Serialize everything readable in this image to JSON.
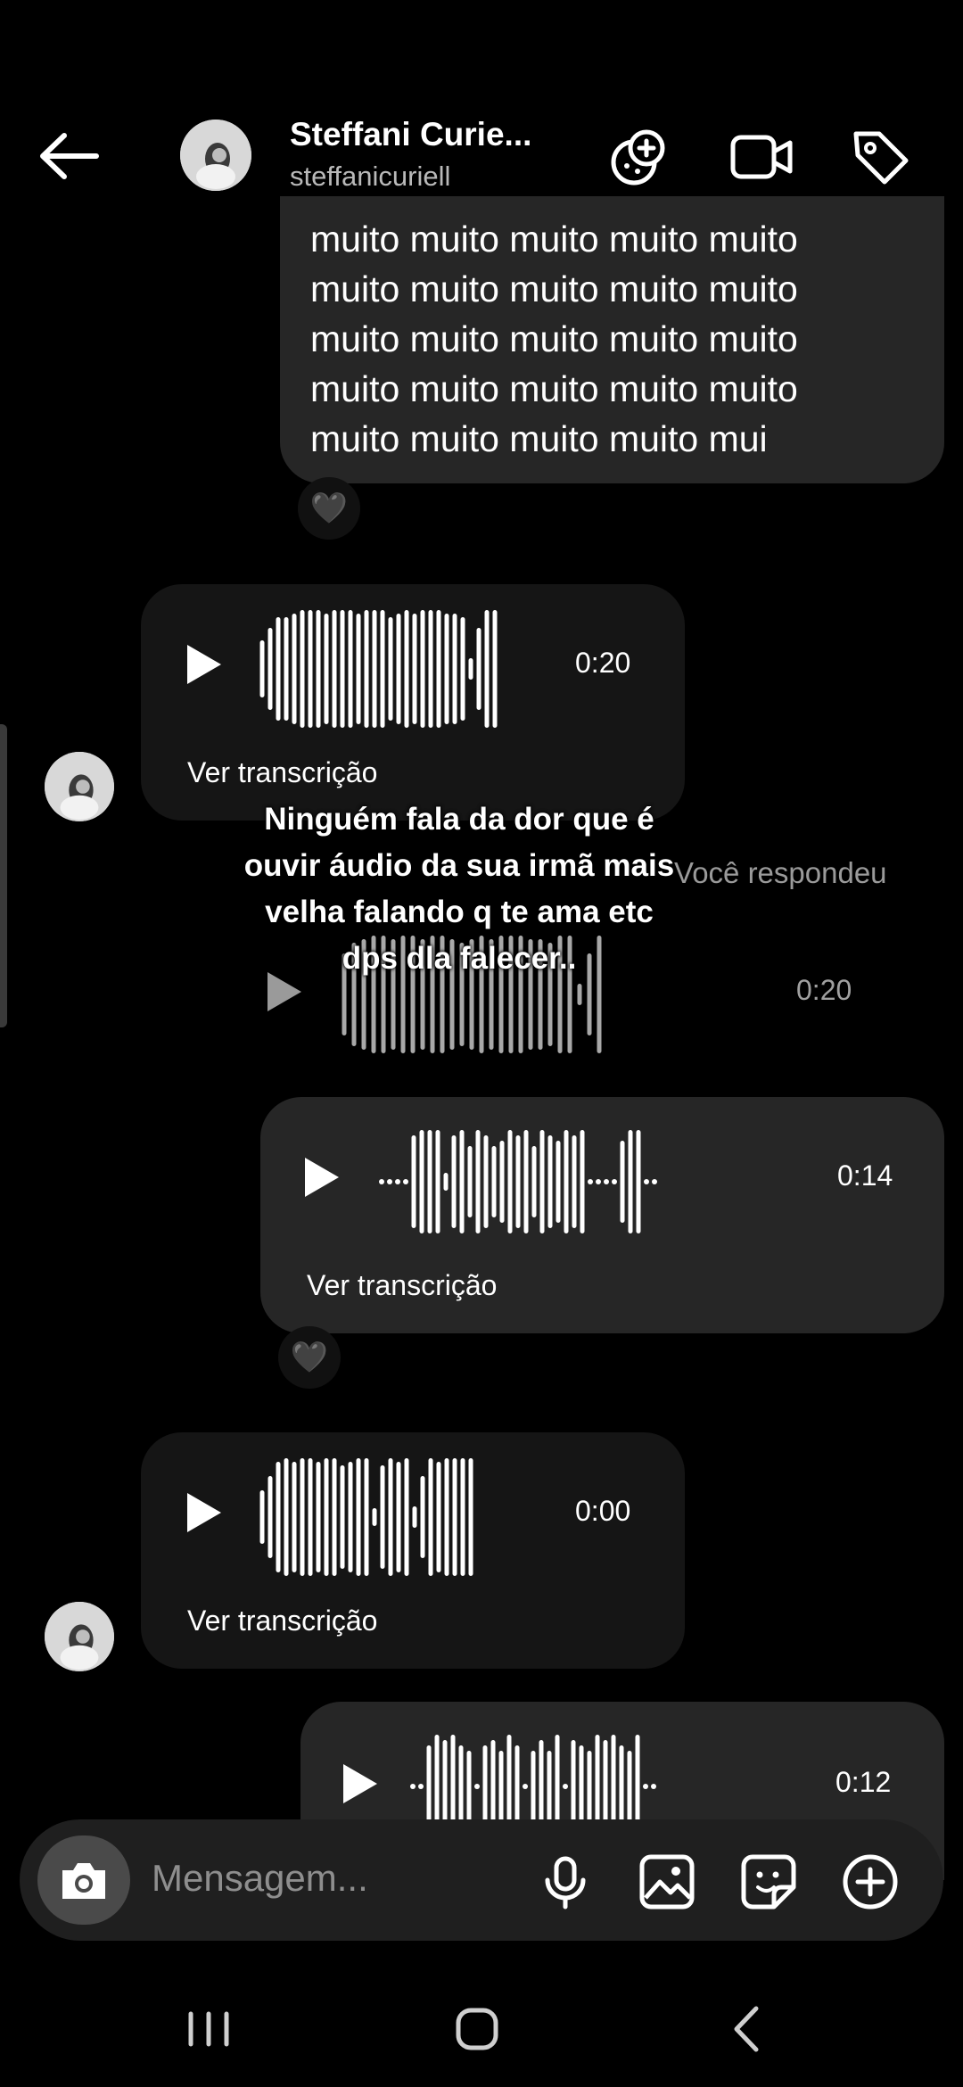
{
  "header": {
    "name": "Steffani Curie...",
    "username": "steffanicuriell",
    "icons": [
      "back-arrow-icon",
      "effects-icon",
      "video-call-icon",
      "tag-icon"
    ]
  },
  "messages": {
    "text_message": "muito muito muito muito muito\nmuito muito muito muito muito\nmuito muito muito muito muito\nmuito muito muito muito muito\nmuito muito muito muito mui",
    "reaction_1": "🖤",
    "audio_1": {
      "duration": "0:20",
      "transcribe_label": "Ver transcrição"
    },
    "reply_label": "Você respondeu",
    "reply_audio": {
      "duration": "0:20"
    },
    "audio_2": {
      "duration": "0:14",
      "transcribe_label": "Ver transcrição"
    },
    "reaction_2": "🖤",
    "audio_3": {
      "duration": "0:00",
      "transcribe_label": "Ver transcrição"
    },
    "audio_4": {
      "duration": "0:12"
    }
  },
  "overlay_caption": "Ninguém fala da dor que é\nouvir áudio da sua irmã mais\nvelha falando q te ama etc\ndps dla falecer..",
  "composer": {
    "placeholder": "Mensagem...",
    "icons": [
      "camera-icon",
      "microphone-icon",
      "gallery-icon",
      "sticker-icon",
      "add-icon"
    ]
  },
  "navbar": {
    "icons": [
      "recents-icon",
      "home-icon",
      "back-icon"
    ]
  }
}
